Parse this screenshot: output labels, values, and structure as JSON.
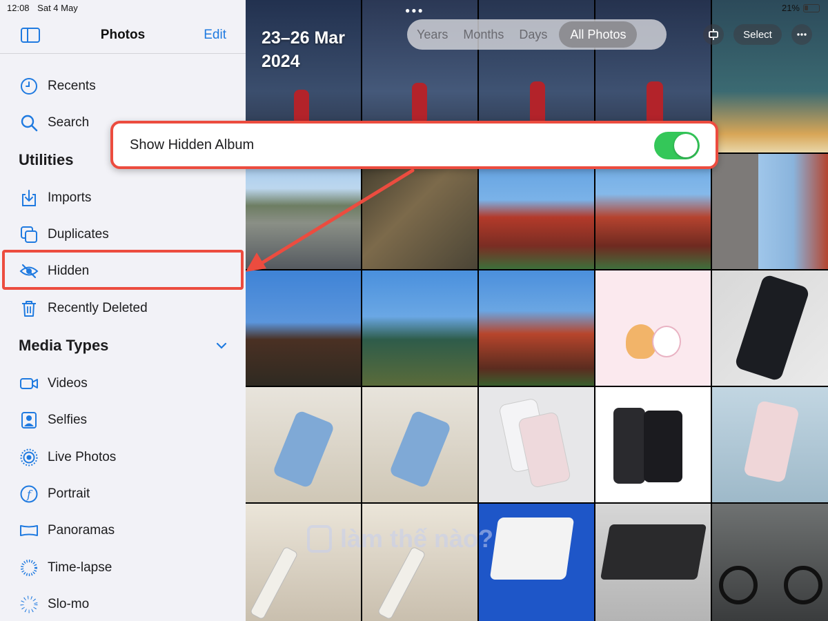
{
  "status_bar": {
    "time": "12:08",
    "date": "Sat 4 May",
    "battery": "21%"
  },
  "sidebar": {
    "title": "Photos",
    "edit_label": "Edit",
    "items_top": [
      {
        "label": "Recents",
        "icon": "clock-icon"
      },
      {
        "label": "Search",
        "icon": "search-icon"
      }
    ],
    "utilities_title": "Utilities",
    "utilities": [
      {
        "label": "Imports",
        "icon": "import-icon"
      },
      {
        "label": "Duplicates",
        "icon": "duplicates-icon"
      },
      {
        "label": "Hidden",
        "icon": "eye-slash-icon"
      },
      {
        "label": "Recently Deleted",
        "icon": "trash-icon"
      }
    ],
    "media_types_title": "Media Types",
    "media_types": [
      {
        "label": "Videos",
        "icon": "video-icon"
      },
      {
        "label": "Selfies",
        "icon": "selfie-icon"
      },
      {
        "label": "Live Photos",
        "icon": "live-photo-icon"
      },
      {
        "label": "Portrait",
        "icon": "portrait-f-icon"
      },
      {
        "label": "Panoramas",
        "icon": "panorama-icon"
      },
      {
        "label": "Time-lapse",
        "icon": "timelapse-icon"
      },
      {
        "label": "Slo-mo",
        "icon": "slomo-icon"
      }
    ]
  },
  "library": {
    "date_range_line1": "23–26 Mar",
    "date_range_line2": "2024",
    "segments": [
      "Years",
      "Months",
      "Days",
      "All Photos"
    ],
    "active_segment": "All Photos",
    "select_label": "Select"
  },
  "callout": {
    "label": "Show Hidden Album",
    "toggle_on": true
  },
  "watermark": "làm thế nào?",
  "colors": {
    "accent": "#1f7ae0",
    "highlight": "#ec4c3f",
    "toggle_on": "#34c759"
  }
}
